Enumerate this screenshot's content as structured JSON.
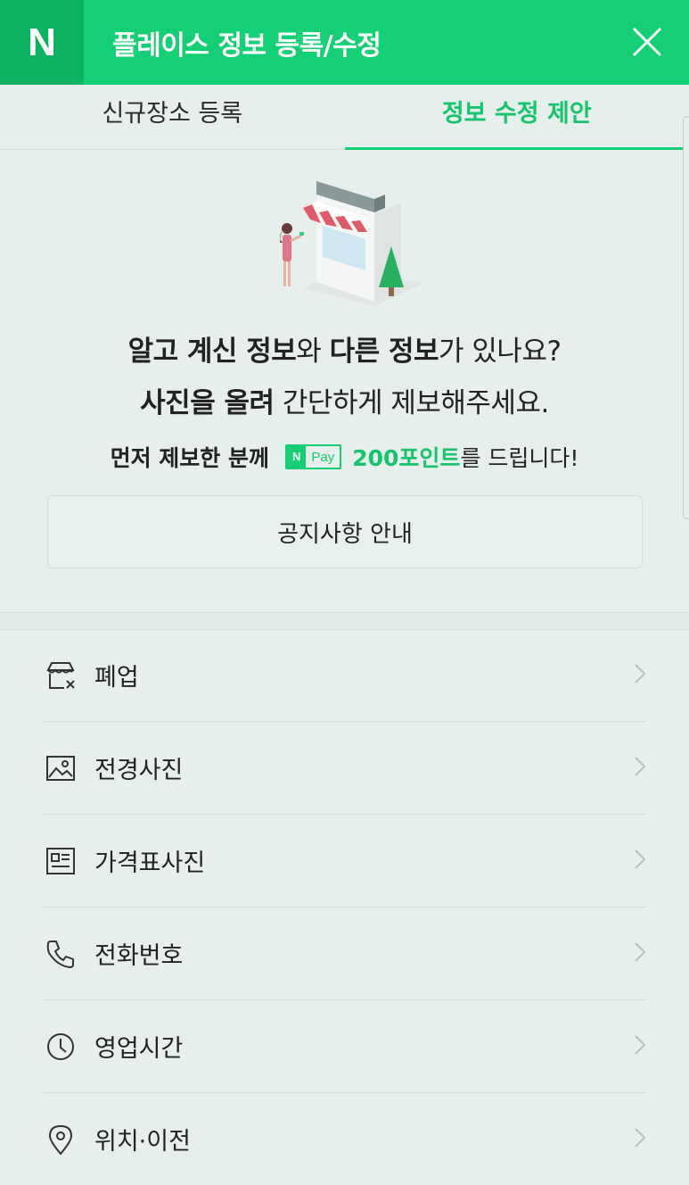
{
  "header": {
    "logo": "N",
    "title": "플레이스 정보 등록/수정"
  },
  "tabs": [
    {
      "label": "신규장소 등록",
      "active": false
    },
    {
      "label": "정보 수정 제안",
      "active": true
    }
  ],
  "hero": {
    "line1": {
      "b1": "알고 계신 정보",
      "t1": "와 ",
      "b2": "다른 정보",
      "t2": "가 있나요?"
    },
    "line2": {
      "b1": "사진을 올려",
      "t1": " 간단하게 제보해주세요."
    },
    "promo": {
      "prefix": "먼저 제보한 분께",
      "npay_n": "N",
      "npay_text": "Pay",
      "points": "200포인트",
      "suffix": "를 드립니다!"
    },
    "notice_button": "공지사항 안내"
  },
  "menu": [
    {
      "label": "폐업",
      "icon": "store-closed-icon"
    },
    {
      "label": "전경사진",
      "icon": "image-icon"
    },
    {
      "label": "가격표사진",
      "icon": "price-list-icon"
    },
    {
      "label": "전화번호",
      "icon": "phone-icon"
    },
    {
      "label": "영업시간",
      "icon": "clock-icon"
    },
    {
      "label": "위치·이전",
      "icon": "location-pin-icon"
    }
  ],
  "colors": {
    "brand": "#15cf74",
    "brand_dark": "#0cb25d",
    "background": "#e6efeb"
  }
}
